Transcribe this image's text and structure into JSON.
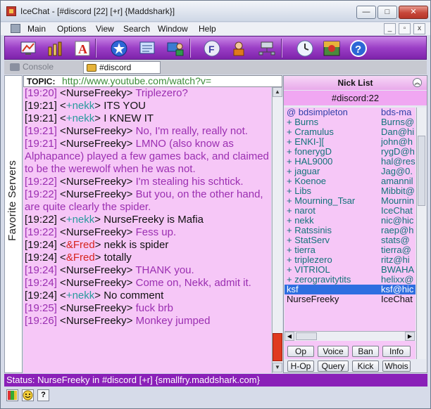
{
  "window": {
    "title": "IceChat - [#discord [22] [+r] {Maddshark}]",
    "buttons": {
      "minimize": "—",
      "maximize": "□",
      "close": "✕"
    }
  },
  "menu": {
    "items": [
      "Main",
      "Options",
      "View",
      "Search",
      "Window",
      "Help"
    ],
    "mdi": {
      "minimize": "_",
      "restore": "▫",
      "close": "x"
    }
  },
  "toolbar": {
    "icons": [
      "quick-connect-icon",
      "tools-icon",
      "font-icon",
      "favorites-star-icon",
      "channel-list-icon",
      "user-icon",
      "fserve-icon",
      "away-icon",
      "network-icon",
      "clock-icon",
      "theme-icon",
      "help-icon"
    ]
  },
  "tabs": [
    {
      "label": "Console"
    },
    {
      "label": "#discord"
    }
  ],
  "favorites": {
    "label": "Favorite Servers"
  },
  "topic": {
    "label": "TOPIC:",
    "text": "http://www.youtube.com/watch?v="
  },
  "chat": {
    "lines": [
      {
        "time": "[19:20]",
        "nick": "NurseFreeky",
        "nick_color": "normal",
        "text": "Triplezero?",
        "action": true
      },
      {
        "time": "[19:21]",
        "nick": "+nekk",
        "nick_color": "green",
        "text": "ITS YOU",
        "action": false
      },
      {
        "time": "[19:21]",
        "nick": "+nekk",
        "nick_color": "green",
        "text": "I KNEW IT",
        "action": false
      },
      {
        "time": "[19:21]",
        "nick": "NurseFreeky",
        "nick_color": "normal",
        "text": "No, I'm really, really not.",
        "action": true
      },
      {
        "time": "[19:21]",
        "nick": "NurseFreeky",
        "nick_color": "normal",
        "text": "LMNO (also know as Alphapance) played a few games back, and claimed to be the werewolf when he was not.",
        "action": true
      },
      {
        "time": "[19:22]",
        "nick": "NurseFreeky",
        "nick_color": "normal",
        "text": "I'm stealing his schtick.",
        "action": true
      },
      {
        "time": "[19:22]",
        "nick": "NurseFreeky",
        "nick_color": "normal",
        "text": "But you, on the other hand, are quite clearly the spider.",
        "action": true
      },
      {
        "time": "[19:22]",
        "nick": "+nekk",
        "nick_color": "green",
        "text": "NurseFreeky is Mafia",
        "action": false
      },
      {
        "time": "[19:22]",
        "nick": "NurseFreeky",
        "nick_color": "normal",
        "text": "Fess up.",
        "action": true
      },
      {
        "time": "[19:24]",
        "nick": "&Fred",
        "nick_color": "red",
        "text": "nekk is spider",
        "action": false
      },
      {
        "time": "[19:24]",
        "nick": "&Fred",
        "nick_color": "red",
        "text": "totally",
        "action": false
      },
      {
        "time": "[19:24]",
        "nick": "NurseFreeky",
        "nick_color": "normal",
        "text": "THANK you.",
        "action": true
      },
      {
        "time": "[19:24]",
        "nick": "NurseFreeky",
        "nick_color": "normal",
        "text": "Come on, Nekk, admit it.",
        "action": true
      },
      {
        "time": "[19:24]",
        "nick": "+nekk",
        "nick_color": "green",
        "text": "No comment",
        "action": false
      },
      {
        "time": "[19:25]",
        "nick": "NurseFreeky",
        "nick_color": "normal",
        "text": "fuck brb",
        "action": true
      },
      {
        "time": "[19:26]",
        "nick": "NurseFreeky",
        "nick_color": "normal",
        "text": "Monkey jumped",
        "action": true
      }
    ]
  },
  "nicklist": {
    "title": "Nick List",
    "channel": "#discord:22",
    "collapse": "︽",
    "nicks": [
      {
        "nick": "@ bdsimpleton",
        "host": "bds-ma",
        "type": "op"
      },
      {
        "nick": "+ Burns",
        "host": "Burns@",
        "type": "voice"
      },
      {
        "nick": "+ Cramulus",
        "host": "Dan@hi",
        "type": "voice"
      },
      {
        "nick": "+ ENKI-][",
        "host": "john@h",
        "type": "voice"
      },
      {
        "nick": "+ fonerygD",
        "host": "rygD@h",
        "type": "voice"
      },
      {
        "nick": "+ HAL9000",
        "host": "hal@res",
        "type": "voice"
      },
      {
        "nick": "+ jaguar",
        "host": "Jag@0.",
        "type": "voice"
      },
      {
        "nick": "+ Koenoe",
        "host": "amannil",
        "type": "voice"
      },
      {
        "nick": "+ Libs",
        "host": "Mibbit@",
        "type": "voice"
      },
      {
        "nick": "+ Mourning_Tsar",
        "host": "Mournin",
        "type": "voice"
      },
      {
        "nick": "+ narot",
        "host": "IceChat",
        "type": "voice"
      },
      {
        "nick": "+ nekk",
        "host": "nic@hic",
        "type": "voice"
      },
      {
        "nick": "+ Ratssinis",
        "host": "raep@h",
        "type": "voice"
      },
      {
        "nick": "+ StatServ",
        "host": "stats@",
        "type": "voice"
      },
      {
        "nick": "+ tierra",
        "host": "tierra@",
        "type": "voice"
      },
      {
        "nick": "+ triplezero",
        "host": "ritz@hi",
        "type": "voice"
      },
      {
        "nick": "+ VITRIOL",
        "host": "BWAHA",
        "type": "voice"
      },
      {
        "nick": "+ zerogravitytits",
        "host": "helixx@",
        "type": "voice"
      },
      {
        "nick": "ksf",
        "host": "ksf@hic",
        "type": "selected"
      },
      {
        "nick": "NurseFreeky",
        "host": "IceChat",
        "type": "plain"
      }
    ],
    "buttons": [
      "Op",
      "Voice",
      "Ban",
      "Info",
      "H-Op",
      "Query",
      "Kick",
      "Whois"
    ]
  },
  "status": {
    "text": "Status: NurseFreeky in #discord [+r] {smallfry.maddshark.com}"
  },
  "bottom": {
    "help": "?"
  }
}
